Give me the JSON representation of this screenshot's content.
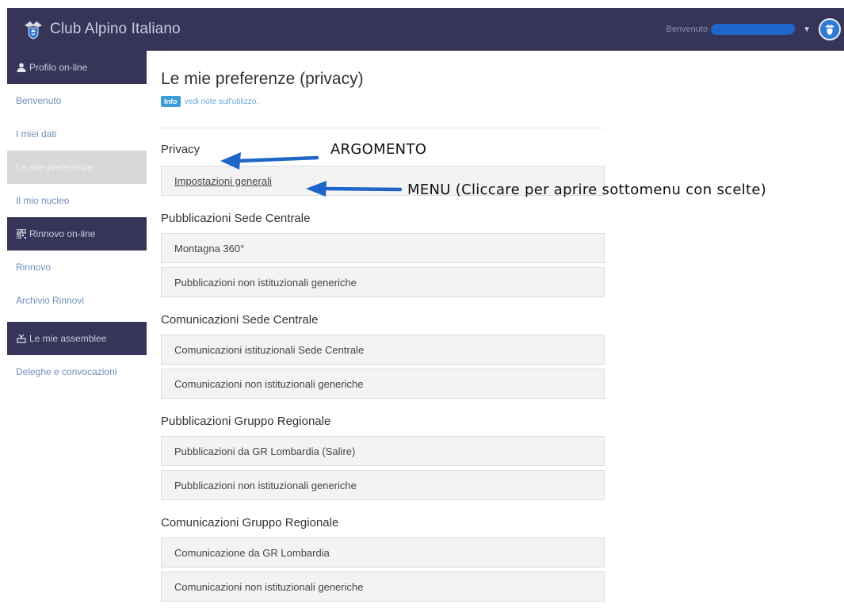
{
  "header": {
    "app_title": "Club Alpino Italiano",
    "welcome": "Benvenuto"
  },
  "sidebar": {
    "sections": [
      {
        "label": "Profilo on-line",
        "icon": "user-icon"
      },
      {
        "label": "Rinnovo on-line",
        "icon": "qrcode-icon"
      },
      {
        "label": "Le mie assemblee",
        "icon": "ballot-icon"
      }
    ],
    "items": [
      {
        "label": "Benvenuto"
      },
      {
        "label": "I miei dati"
      },
      {
        "label": "Le mie preferenze",
        "active": true
      },
      {
        "label": "Il mio nucleo"
      },
      {
        "label": "Rinnovo"
      },
      {
        "label": "Archivio Rinnovi"
      },
      {
        "label": "Deleghe e convocazioni"
      }
    ]
  },
  "main": {
    "title": "Le mie preferenze (privacy)",
    "info_badge": "Info",
    "info_link": "vedi note sull'utilizzo.",
    "sections": [
      {
        "title": "Privacy",
        "items": [
          "Impostazioni generali"
        ]
      },
      {
        "title": "Pubblicazioni Sede Centrale",
        "items": [
          "Montagna 360°",
          "Pubblicazioni non istituzionali generiche"
        ]
      },
      {
        "title": "Comunicazioni Sede Centrale",
        "items": [
          "Comunicazioni istituzionali Sede Centrale",
          "Comunicazioni non istituzionali generiche"
        ]
      },
      {
        "title": "Pubblicazioni Gruppo Regionale",
        "items": [
          "Pubblicazioni da GR Lombardia (Salire)",
          "Pubblicazioni non istituzionali generiche"
        ]
      },
      {
        "title": "Comunicazioni Gruppo Regionale",
        "items": [
          "Comunicazione da GR Lombardia",
          "Comunicazioni non istituzionali generiche"
        ]
      }
    ]
  },
  "annotations": {
    "argomento": "ARGOMENTO",
    "menu": "MENU (Cliccare per aprire sottomenu con scelte)"
  },
  "colors": {
    "header_bg": "#363559",
    "sidebar_link": "#6f8fba",
    "arrow": "#1e66c9",
    "info_badge": "#3a9fd8"
  }
}
